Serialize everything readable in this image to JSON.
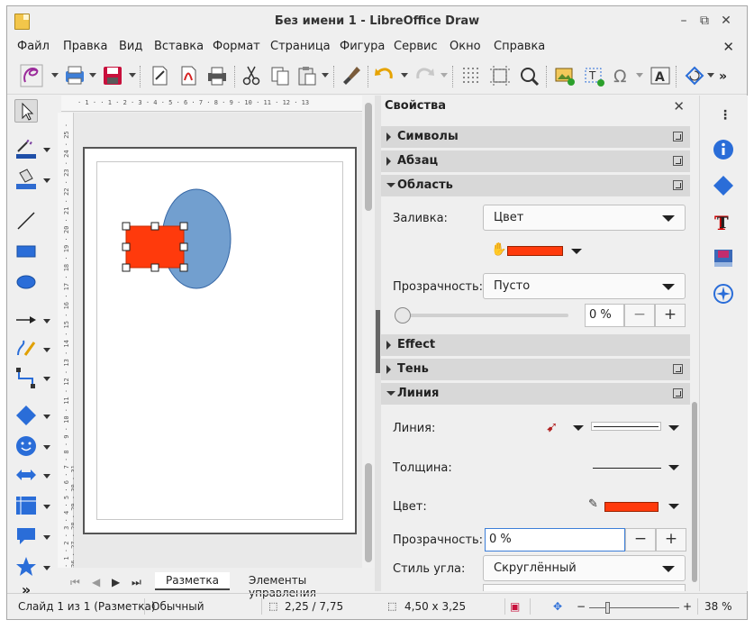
{
  "window": {
    "title": "Без имени 1 - LibreOffice Draw",
    "minimize": "–",
    "maximize": "⧉",
    "close": "✕"
  },
  "menu": {
    "items": [
      "Файл",
      "Правка",
      "Вид",
      "Вставка",
      "Формат",
      "Страница",
      "Фигура",
      "Сервис",
      "Окно",
      "Справка"
    ],
    "close_doc": "✕"
  },
  "ruler": {
    "h_ticks": "· 1 · · 1 · 2 · 3 · 4 · 5 · 6 · 7 · 8 · 9 · 10 · 11 · 12 · 13",
    "v_ticks": "· 1 · 2 · 3 · 4 · 5 · 6 · 7 · 8 · 9 · 10 · 11 · 12 · 13 · 14 · 15 · 16 · 17 · 18 · 19 · 20 · 21 · 22 · 23 · 24 · 25 · 26 · 27 · 28 · 29 · 30 · 31"
  },
  "tabs": {
    "items": [
      "Разметка",
      "Элементы управления"
    ]
  },
  "sidebar": {
    "title": "Свойства",
    "close": "✕",
    "sections": {
      "symbols": "Символы",
      "paragraph": "Абзац",
      "area": "Область",
      "effect": "Effect",
      "shadow": "Тень",
      "line": "Линия"
    },
    "area": {
      "fill_label": "Заливка:",
      "fill_value": "Цвет",
      "fill_color": "#ff3a0c",
      "transparency_label": "Прозрачность:",
      "transparency_value": "Пусто",
      "transparency_pct": "0 %",
      "minus": "−",
      "plus": "+"
    },
    "line": {
      "line_label": "Линия:",
      "width_label": "Толщина:",
      "color_label": "Цвет:",
      "color": "#ff3a0c",
      "transparency_label": "Прозрачность:",
      "transparency_value": "0 %",
      "corner_label": "Стиль угла:",
      "corner_value": "Скруглённый",
      "minus": "−",
      "plus": "+"
    }
  },
  "shapes": {
    "rect_color": "#ff3a0c",
    "ellipse_color": "#729fcf"
  },
  "status": {
    "slide": "Слайд 1 из 1 (Разметка)",
    "style": "Обычный",
    "position": "2,25 / 7,75",
    "size": "4,50 x 3,25",
    "zoom": "38 %",
    "zoom_minus": "−",
    "zoom_plus": "+"
  }
}
